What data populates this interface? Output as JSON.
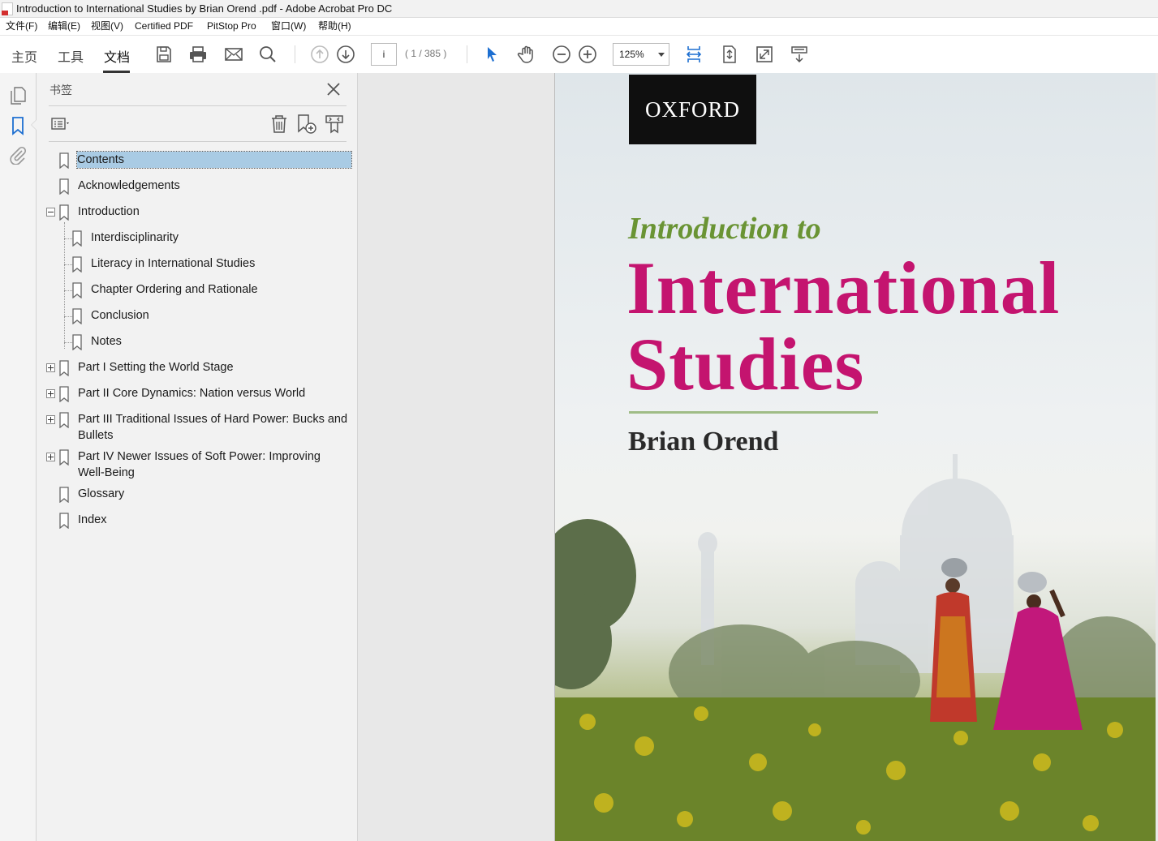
{
  "window": {
    "title": "Introduction to International Studies by Brian Orend .pdf - Adobe Acrobat Pro DC"
  },
  "menu": [
    "文件(F)",
    "编辑(E)",
    "视图(V)",
    "Certified PDF",
    "PitStop Pro",
    "窗口(W)",
    "帮助(H)"
  ],
  "tabs": {
    "home": "主页",
    "tools": "工具",
    "document": "文档"
  },
  "toolbar": {
    "page_value": "i",
    "page_count": "( 1 / 385 )",
    "zoom": "125%"
  },
  "bookmarks": {
    "header": "书签",
    "items": [
      {
        "label": "Contents",
        "selected": true
      },
      {
        "label": "Acknowledgements"
      },
      {
        "label": "Introduction",
        "expanded": true
      },
      {
        "label": "Interdisciplinarity"
      },
      {
        "label": "Literacy in International Studies"
      },
      {
        "label": "Chapter Ordering and Rationale"
      },
      {
        "label": "Conclusion"
      },
      {
        "label": "Notes"
      },
      {
        "label": "Part I Setting the World Stage",
        "collapsed": true
      },
      {
        "label": "Part II Core Dynamics: Nation versus World",
        "collapsed": true
      },
      {
        "label_line1": "Part III Traditional Issues of Hard Power: Bucks and",
        "label_line2": "Bullets",
        "collapsed": true
      },
      {
        "label_line1": "Part IV Newer Issues of Soft Power: Improving",
        "label_line2": "Well-Being",
        "collapsed": true
      },
      {
        "label": "Glossary"
      },
      {
        "label": "Index"
      }
    ]
  },
  "cover": {
    "publisher": "OXFORD",
    "subtitle": "Introduction to",
    "title_line1": "International",
    "title_line2": "Studies",
    "author": "Brian Orend",
    "title_color": "#c4146f",
    "subtitle_color": "#6a9434"
  },
  "colors": {
    "selection": "#a9cbe4",
    "accent": "#1d6fd1"
  }
}
